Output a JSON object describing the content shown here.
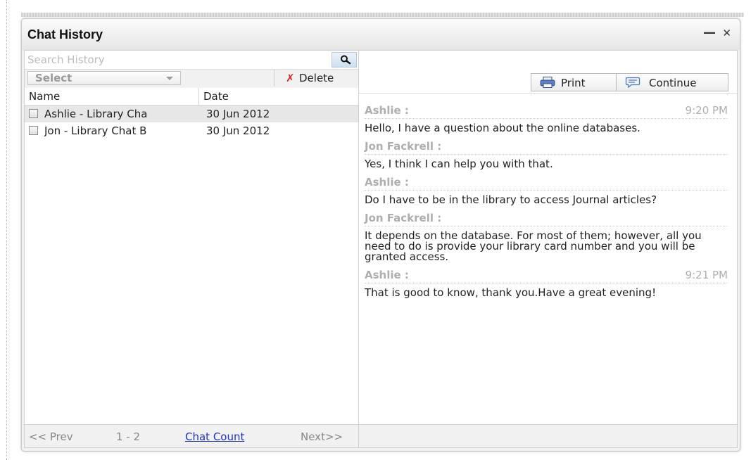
{
  "window": {
    "title": "Chat History",
    "minimize_glyph": "—",
    "close_glyph": "✕"
  },
  "search": {
    "placeholder": "Search History",
    "icon": "search-icon"
  },
  "toolbar": {
    "select_label": "Select",
    "delete_label": "Delete",
    "delete_icon": "✗"
  },
  "list": {
    "columns": [
      "Name",
      "Date"
    ],
    "rows": [
      {
        "name": "Ashlie - Library Cha",
        "date": "30 Jun 2012"
      },
      {
        "name": "Jon - Library Chat B",
        "date": "30 Jun 2012"
      }
    ]
  },
  "pager": {
    "prev": "<< Prev",
    "range": "1 - 2",
    "count": "Chat Count",
    "next": "Next>>"
  },
  "actions": {
    "print_label": "Print",
    "continue_label": "Continue"
  },
  "transcript": {
    "messages": [
      {
        "sender": "Ashlie :",
        "time": "9:20 PM",
        "text": "Hello, I have a question about the online databases."
      },
      {
        "sender": "Jon Fackrell :",
        "time": "",
        "text": "Yes, I think I can help you with that."
      },
      {
        "sender": "Ashlie :",
        "time": "",
        "text": "Do I have to be in the library to access Journal articles?"
      },
      {
        "sender": "Jon Fackrell :",
        "time": "",
        "text": "It depends on the database. For most of them; however, all you need to do is provide your library card number and you will be granted access."
      },
      {
        "sender": "Ashlie :",
        "time": "9:21 PM",
        "text": "That is good to know, thank you.Have a great evening!"
      }
    ]
  },
  "colors": {
    "link": "#2233bb",
    "delete": "#dd2222",
    "sender": "#aeaeae"
  }
}
